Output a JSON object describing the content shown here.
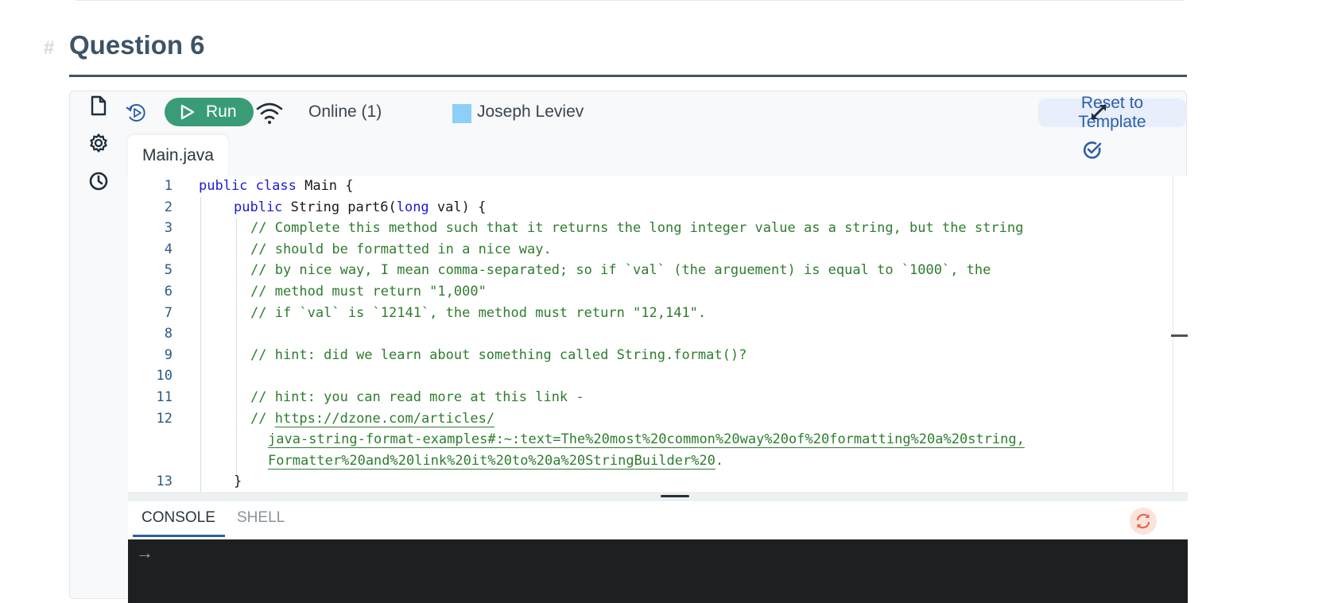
{
  "section": {
    "hash": "#",
    "title": "Question 6"
  },
  "toolbar": {
    "run_label": "Run",
    "online_label": "Online (1)",
    "user_name": "Joseph Leviev",
    "user_color": "#8ccff7",
    "reset_label": "Reset to Template"
  },
  "side_rail": {
    "icons": [
      "file-icon",
      "settings-gear-icon",
      "history-clock-icon"
    ]
  },
  "tabs": [
    {
      "label": "Main.java",
      "active": true
    }
  ],
  "code": {
    "lines": [
      {
        "n": "1",
        "tokens": [
          {
            "t": "public",
            "c": "kw"
          },
          {
            "t": " ",
            "c": ""
          },
          {
            "t": "class",
            "c": "kw"
          },
          {
            "t": " Main {",
            "c": ""
          }
        ]
      },
      {
        "n": "2",
        "tokens": [
          {
            "t": "public",
            "c": "kw"
          },
          {
            "t": " String part6(",
            "c": ""
          },
          {
            "t": "long",
            "c": "kw"
          },
          {
            "t": " val) {",
            "c": ""
          }
        ]
      },
      {
        "n": "3",
        "tokens": [
          {
            "t": "// Complete this method such that it returns the long integer value as a string, but the string",
            "c": "cmt"
          }
        ]
      },
      {
        "n": "4",
        "tokens": [
          {
            "t": "// should be formatted in a nice way.",
            "c": "cmt"
          }
        ]
      },
      {
        "n": "5",
        "tokens": [
          {
            "t": "// by nice way, I mean comma-separated; so if `val` (the arguement) is equal to `1000`, the",
            "c": "cmt"
          }
        ]
      },
      {
        "n": "6",
        "tokens": [
          {
            "t": "// method must return \"1,000\"",
            "c": "cmt"
          }
        ]
      },
      {
        "n": "7",
        "tokens": [
          {
            "t": "// if `val` is `12141`, the method must return \"12,141\".",
            "c": "cmt"
          }
        ]
      },
      {
        "n": "8",
        "tokens": []
      },
      {
        "n": "9",
        "tokens": [
          {
            "t": "// hint: did we learn about something called String.format()?",
            "c": "cmt"
          }
        ]
      },
      {
        "n": "10",
        "tokens": []
      },
      {
        "n": "11",
        "tokens": [
          {
            "t": "// hint: you can read more at this link -",
            "c": "cmt"
          }
        ]
      },
      {
        "n": "12",
        "tokens": [
          {
            "t": "// ",
            "c": "cmt"
          },
          {
            "t": "https://dzone.com/articles/",
            "c": "lnk"
          }
        ]
      },
      {
        "n": "",
        "tokens": [
          {
            "t": "java-string-format-examples#:~:text=The%20most%20common%20way%20of%20formatting%20a%20string,",
            "c": "lnk"
          }
        ]
      },
      {
        "n": "",
        "tokens": [
          {
            "t": "Formatter%20and%20link%20it%20to%20a%20StringBuilder%20",
            "c": "lnk"
          },
          {
            "t": ".",
            "c": "cmt"
          }
        ]
      },
      {
        "n": "13",
        "tokens": [
          {
            "t": "}",
            "c": ""
          }
        ]
      }
    ]
  },
  "console": {
    "tabs": [
      "CONSOLE",
      "SHELL"
    ],
    "active": "CONSOLE",
    "prompt": "→"
  }
}
